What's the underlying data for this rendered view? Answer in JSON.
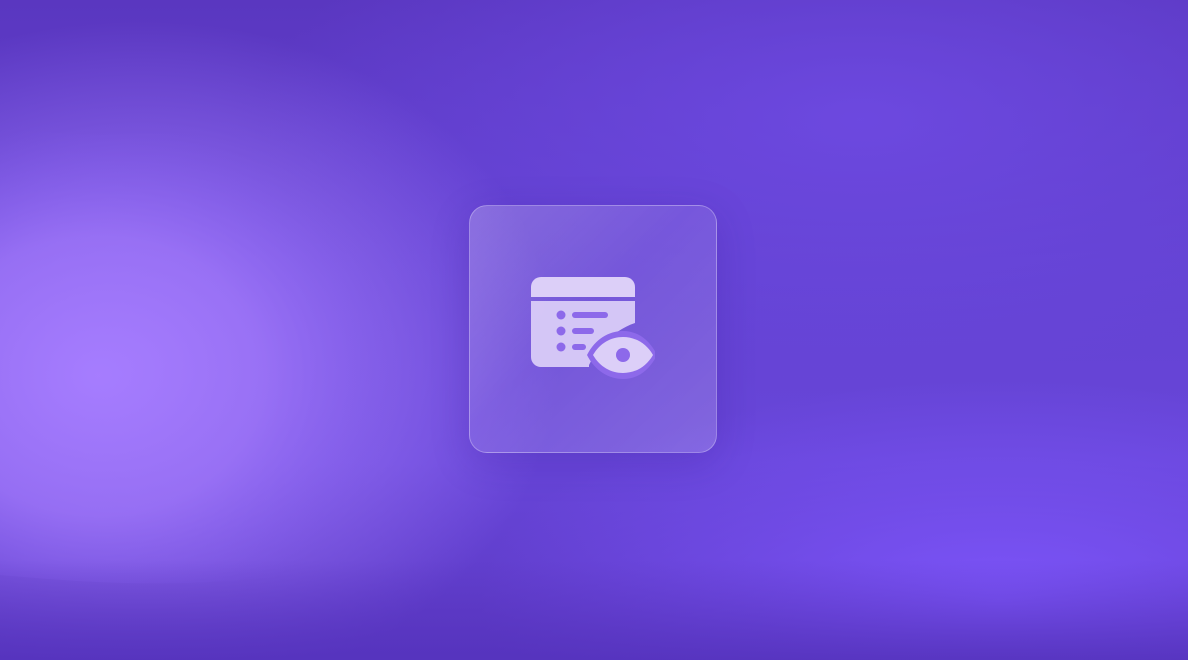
{
  "scene": {
    "icon": "calendar-list-eye-icon",
    "colors": {
      "background_dark": "#5a37c0",
      "background_light": "#a880ff",
      "icon_fill": "#d9ccf7",
      "card_border": "rgba(255,255,255,0.28)"
    }
  }
}
